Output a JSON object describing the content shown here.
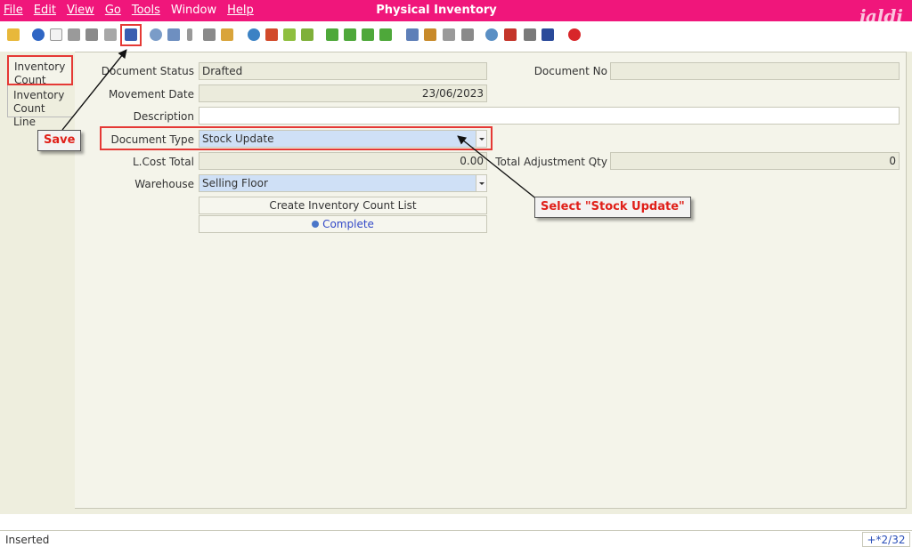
{
  "menu": {
    "file": "File",
    "edit": "Edit",
    "view": "View",
    "go": "Go",
    "tools": "Tools",
    "window": "Window",
    "help": "Help"
  },
  "window": {
    "title": "Physical Inventory",
    "logo": "jaldi"
  },
  "toolbar": {
    "icons": [
      "undo-icon",
      "help-icon",
      "new-icon",
      "copy-icon",
      "delete-icon",
      "delete-selection-icon",
      "save-icon",
      "refresh-icon",
      "find-icon",
      "attachment-icon",
      "chat-icon",
      "grid-toggle-icon",
      "history-icon",
      "home-icon",
      "previous-record-icon",
      "next-record-icon",
      "first-record-icon",
      "previous-page-icon",
      "next-page-icon",
      "last-record-icon",
      "report-icon",
      "archive-icon",
      "print-preview-icon",
      "print-icon",
      "zoom-across-icon",
      "workflow-icon",
      "product-info-icon",
      "request-icon",
      "close-window-icon"
    ]
  },
  "tabs": [
    "Inventory Count",
    "Inventory Count Line"
  ],
  "form": {
    "document_status": {
      "label": "Document Status",
      "value": "Drafted"
    },
    "document_no": {
      "label": "Document No",
      "value": ""
    },
    "movement_date": {
      "label": "Movement Date",
      "value": "23/06/2023"
    },
    "description": {
      "label": "Description",
      "value": ""
    },
    "document_type": {
      "label": "Document Type",
      "value": "Stock Update"
    },
    "lcost_total": {
      "label": "L.Cost Total",
      "value": "0.00"
    },
    "total_adjustment_qty": {
      "label": "Total Adjustment Qty",
      "value": "0"
    },
    "warehouse": {
      "label": "Warehouse",
      "value": "Selling Floor"
    }
  },
  "buttons": {
    "create_count_list": "Create Inventory Count List",
    "complete": "Complete"
  },
  "annotations": {
    "save": "Save",
    "select_stock_update": "Select \"Stock Update\""
  },
  "status": {
    "text": "Inserted",
    "record": "+*2/32"
  },
  "colors": {
    "titlebar": "#f0167b",
    "highlight": "#e53935",
    "selected_field": "#cfe0f6"
  }
}
